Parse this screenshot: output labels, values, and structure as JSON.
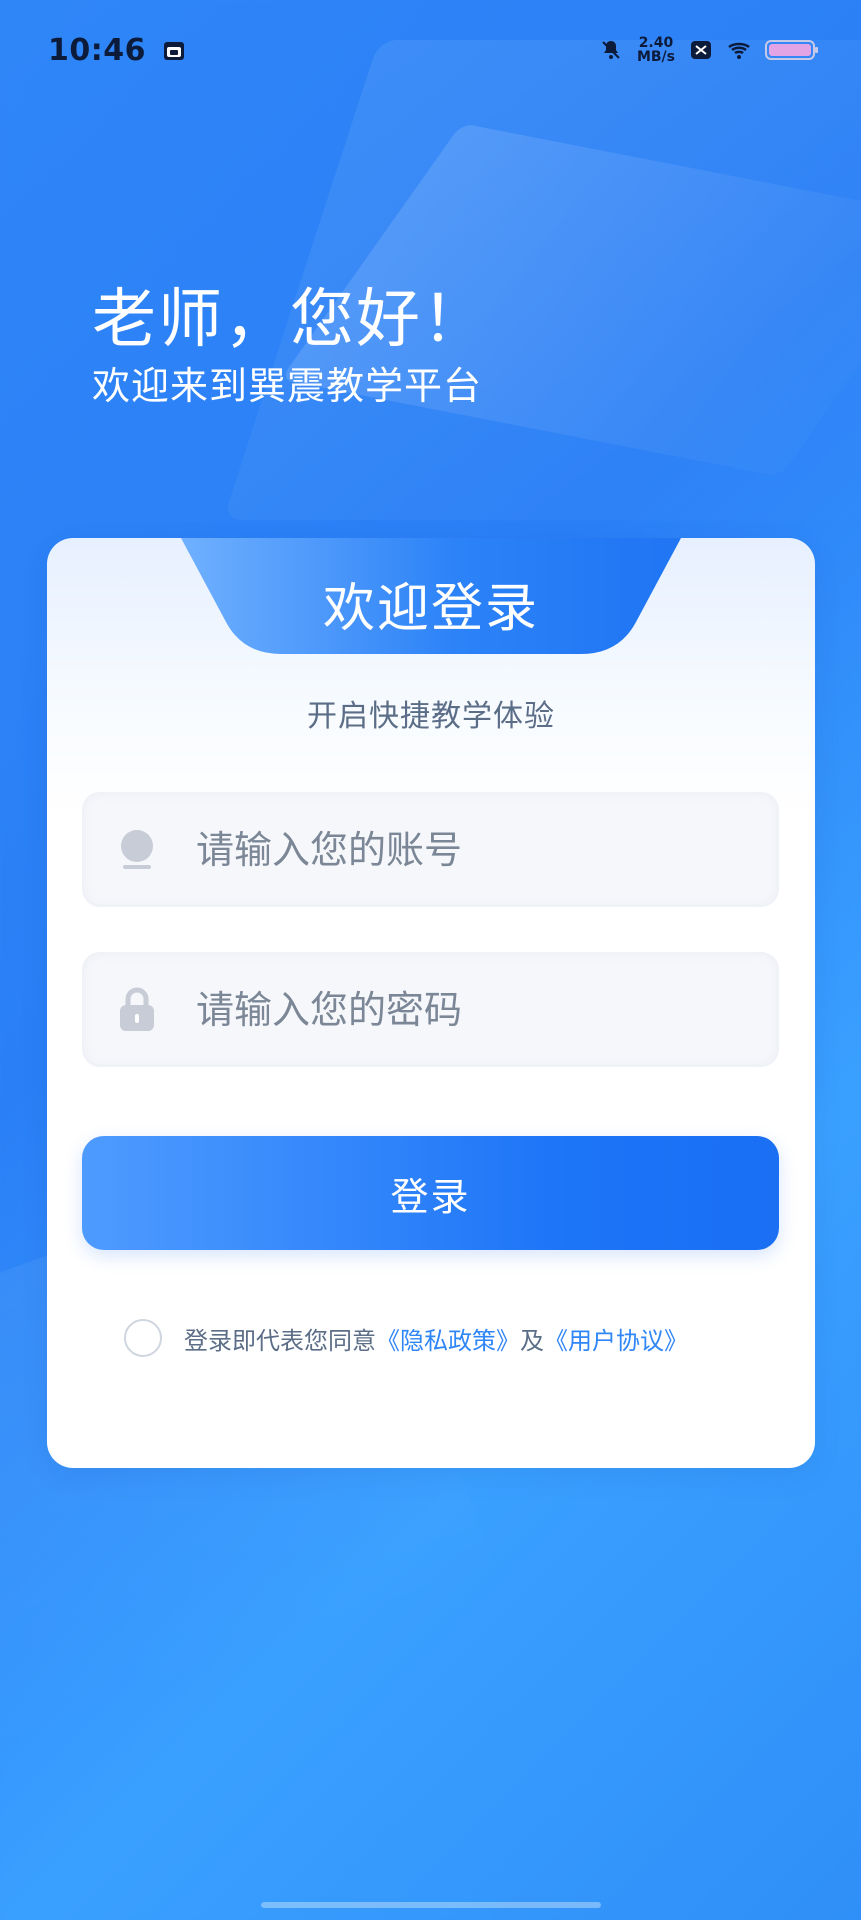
{
  "status_bar": {
    "time": "10:46",
    "network_speed_top": "2.40",
    "network_speed_bottom": "MB/s"
  },
  "greeting": {
    "title": "老师，您好！",
    "subtitle": "欢迎来到巽震教学平台"
  },
  "login_card": {
    "title": "欢迎登录",
    "subtitle": "开启快捷教学体验",
    "account_placeholder": "请输入您的账号",
    "password_placeholder": "请输入您的密码",
    "login_button": "登录",
    "agreement_prefix": "登录即代表您同意",
    "privacy_link": "《隐私政策》",
    "agreement_and": "及",
    "user_agreement_link": "《用户协议》"
  },
  "icons": {
    "calendar": "calendar-icon",
    "notifications_off": "bell-off-icon",
    "close_small": "close-small-icon",
    "wifi": "wifi-icon",
    "battery": "battery-icon",
    "user": "user-icon",
    "lock": "lock-icon",
    "checkbox": "radio-circle-icon"
  },
  "colors": {
    "primary": "#2F86F7",
    "button_gradient_start": "#4E9BFF",
    "button_gradient_end": "#1A6FF3",
    "text_muted": "#5B6D87",
    "input_bg": "#F6F7FB"
  }
}
